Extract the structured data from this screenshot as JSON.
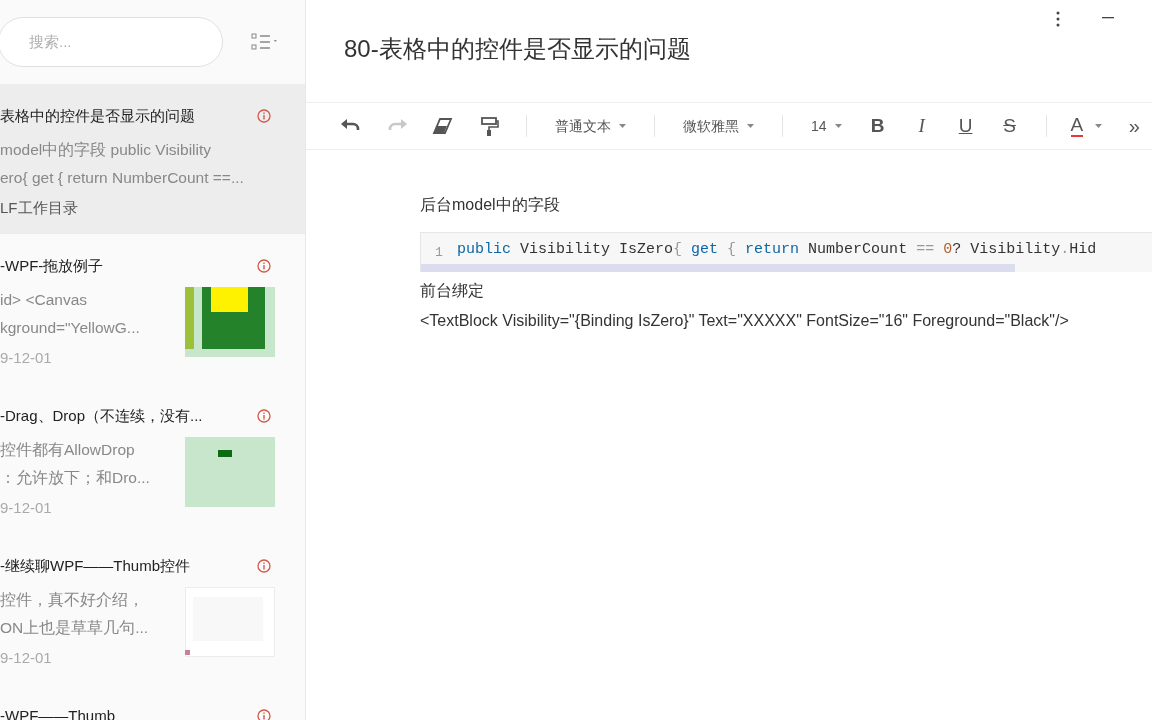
{
  "sidebar": {
    "search": {
      "placeholder": "搜索..."
    },
    "notes": [
      {
        "title": "表格中的控件是否显示的问题",
        "lines": [
          "model中的字段 public Visibility",
          "ero{ get { return NumberCount ==..."
        ],
        "footer": "LF工作目录",
        "selected": true,
        "thumbnail": false
      },
      {
        "title": "-WPF-拖放例子",
        "lines": [
          "id> <Canvas",
          "kground=\"YellowG..."
        ],
        "footer": "9-12-01",
        "selected": false,
        "thumbnail": true
      },
      {
        "title": "-Drag、Drop（不连续，没有...",
        "lines": [
          "控件都有AllowDrop",
          "：允许放下；和Dro..."
        ],
        "footer": "9-12-01",
        "selected": false,
        "thumbnail": true
      },
      {
        "title": "-继续聊WPF——Thumb控件",
        "lines": [
          "控件，真不好介绍，",
          "ON上也是草草几句..."
        ],
        "footer": "9-12-01",
        "selected": false,
        "thumbnail": true
      },
      {
        "title": "-WPF——Thumb",
        "selected": false,
        "thumbnail": false
      }
    ]
  },
  "editor": {
    "title": "80-表格中的控件是否显示的问题",
    "toolbar": [
      {
        "kind": "undo",
        "disabled": false
      },
      {
        "kind": "redo",
        "disabled": true
      },
      {
        "kind": "eraser",
        "disabled": false
      },
      {
        "kind": "painter",
        "disabled": false
      },
      {
        "kind": "divider"
      },
      {
        "kind": "dropdown",
        "label": "普通文本"
      },
      {
        "kind": "divider"
      },
      {
        "kind": "dropdown",
        "label": "微软雅黑"
      },
      {
        "kind": "divider"
      },
      {
        "kind": "dropdown",
        "label": "14"
      },
      {
        "kind": "bold",
        "label": "B"
      },
      {
        "kind": "italic",
        "label": "I"
      },
      {
        "kind": "underline",
        "label": "U"
      },
      {
        "kind": "strike",
        "label": "S"
      },
      {
        "kind": "divider"
      },
      {
        "kind": "color",
        "label": "A",
        "color": "#e53935"
      },
      {
        "kind": "more",
        "label": "»"
      }
    ],
    "blocks": [
      {
        "kind": "paragraph",
        "text": "后台model中的字段"
      },
      {
        "kind": "code",
        "line_number": "1",
        "tokens": [
          {
            "kind": "keyword",
            "text": "public"
          },
          {
            "kind": "plain",
            "text": " Visibility IsZero"
          },
          {
            "kind": "punct",
            "text": "{ "
          },
          {
            "kind": "keyword",
            "text": "get"
          },
          {
            "kind": "punct",
            "text": " { "
          },
          {
            "kind": "keyword",
            "text": "return"
          },
          {
            "kind": "plain",
            "text": " NumberCount "
          },
          {
            "kind": "punct",
            "text": "== "
          },
          {
            "kind": "number",
            "text": "0"
          },
          {
            "kind": "plain",
            "text": "? Visibility"
          },
          {
            "kind": "punct",
            "text": "."
          },
          {
            "kind": "plain",
            "text": "Hid"
          }
        ]
      },
      {
        "kind": "paragraph",
        "text": "前台绑定"
      },
      {
        "kind": "paragraph",
        "text": "<TextBlock Visibility=\"{Binding IsZero}\" Text=\"XXXXX\" FontSize=\"16\" Foreground=\"Black\"/>"
      }
    ]
  }
}
